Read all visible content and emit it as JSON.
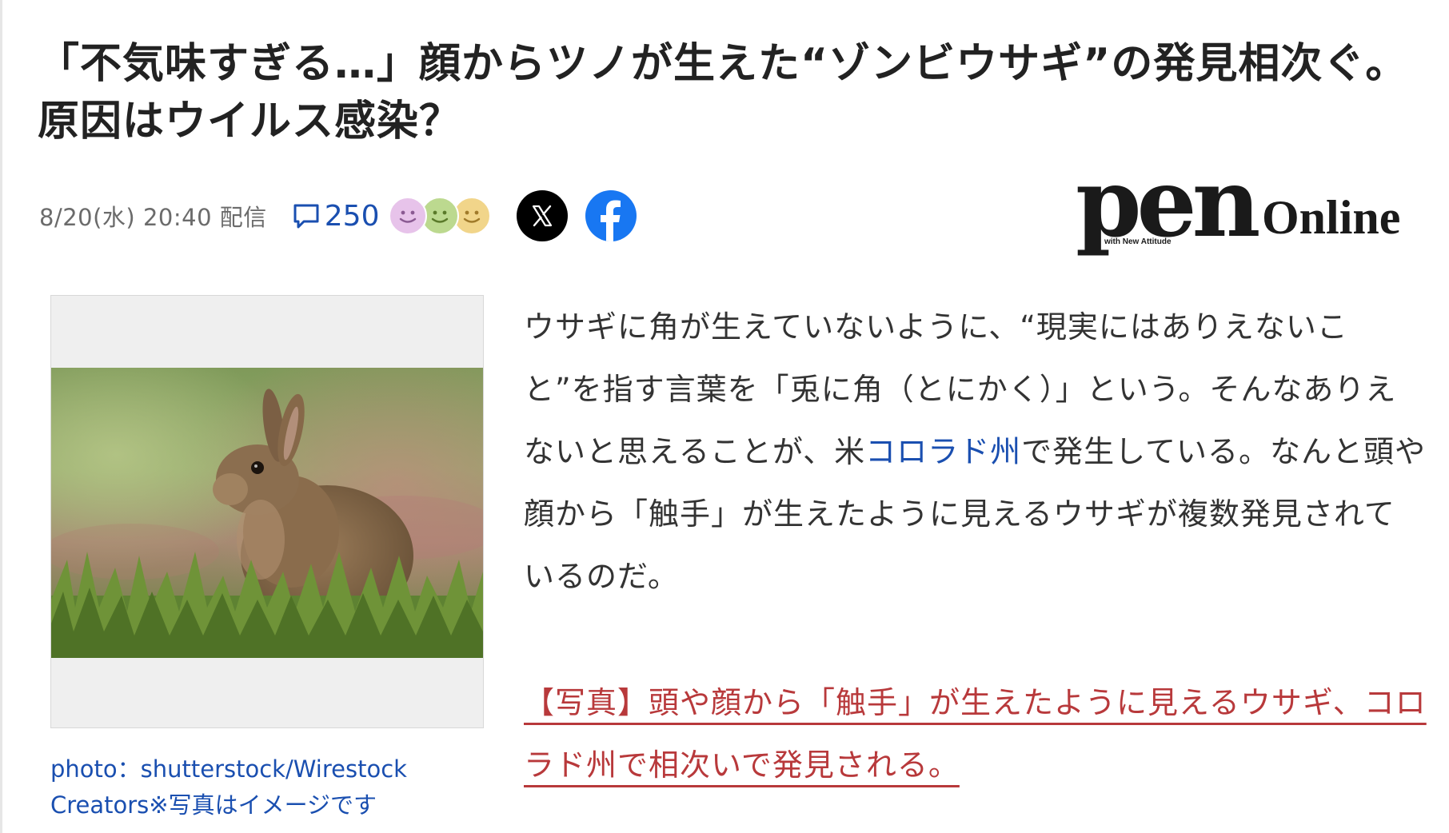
{
  "article": {
    "headline": "「不気味すぎる…」顔からツノが生えた“ゾンビウサギ”の発見相次ぐ。原因はウイルス感染？",
    "date": "8/20(水) 20:40 配信",
    "comment_count": "250"
  },
  "reactions": [
    "smile-face-purple-icon",
    "smile-face-green-icon",
    "smile-face-yellow-icon"
  ],
  "share": {
    "x_icon": "x-logo-icon",
    "facebook_icon": "facebook-logo-icon"
  },
  "brand": {
    "name": "pen",
    "tagline": "with New Attitude",
    "suffix": "Online"
  },
  "photo": {
    "caption": "photo：shutterstock/Wirestock Creators※写真はイメージです"
  },
  "body": {
    "part1": "ウサギに角が生えていないように、“現実にはありえないこと”を指す言葉を「兎に角（とにかく）」という。そんなありえないと思えることが、米",
    "link": "コロラド州",
    "part2": "で発生している。なんと頭や顔から「触手」が生えたように見えるウサギが複数発見されているのだ。"
  },
  "photo_link": {
    "text": "【写真】頭や顔から「触手」が生えたように見えるウサギ、コロラド州で相次いで発見される。"
  },
  "colors": {
    "link_blue": "#1a4fb0",
    "link_red": "#b8393b",
    "facebook_blue": "#1877f2"
  }
}
